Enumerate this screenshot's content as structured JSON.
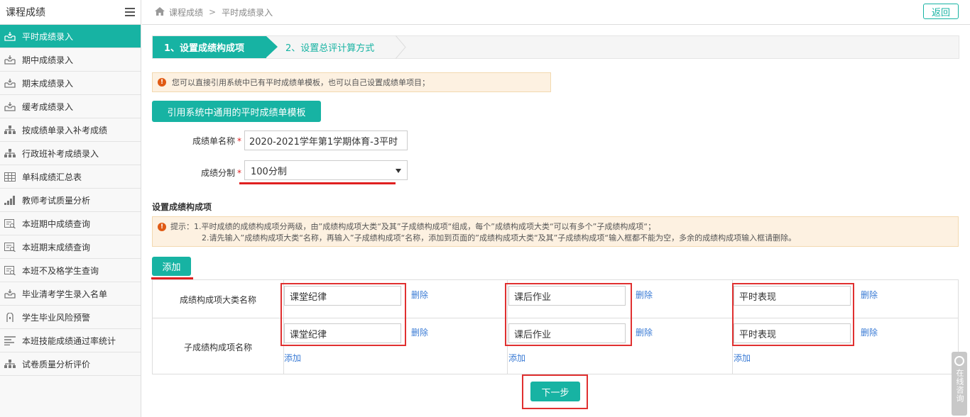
{
  "sidebar": {
    "title": "课程成绩",
    "items": [
      {
        "label": "平时成绩录入",
        "icon": "inbox-icon",
        "active": true
      },
      {
        "label": "期中成绩录入",
        "icon": "inbox-icon"
      },
      {
        "label": "期末成绩录入",
        "icon": "inbox-icon"
      },
      {
        "label": "缓考成绩录入",
        "icon": "inbox-icon"
      },
      {
        "label": "按成绩单录入补考成绩",
        "icon": "sitemap-icon"
      },
      {
        "label": "行政班补考成绩录入",
        "icon": "sitemap-icon"
      },
      {
        "label": "单科成绩汇总表",
        "icon": "table-icon"
      },
      {
        "label": "教师考试质量分析",
        "icon": "signal-icon"
      },
      {
        "label": "本班期中成绩查询",
        "icon": "search-list-icon"
      },
      {
        "label": "本班期末成绩查询",
        "icon": "search-list-icon"
      },
      {
        "label": "本班不及格学生查询",
        "icon": "search-list-icon"
      },
      {
        "label": "毕业清考学生录入名单",
        "icon": "inbox-icon"
      },
      {
        "label": "学生毕业风险预警",
        "icon": "lock-icon"
      },
      {
        "label": "本班技能成绩通过率统计",
        "icon": "align-left-icon"
      },
      {
        "label": "试卷质量分析评价",
        "icon": "sitemap-icon"
      }
    ]
  },
  "header": {
    "breadcrumb": [
      "课程成绩",
      "平时成绩录入"
    ],
    "back_label": "返回"
  },
  "steps": {
    "step1": "1、设置成绩构成项",
    "step2": "2、设置总评计算方式"
  },
  "notice1": "您可以直接引用系统中已有平时成绩单模板，也可以自己设置成绩单项目；",
  "template_button": "引用系统中通用的平时成绩单模板",
  "form": {
    "name_label": "成绩单名称",
    "name_value": "2020-2021学年第1学期体育-3平时",
    "grade_label": "成绩分制",
    "grade_value": "100分制",
    "required_mark": "*"
  },
  "section_title": "设置成绩构成项",
  "notice2": {
    "line1": "提示：1.平时成绩的成绩构成项分两级，由”成绩构成项大类“及其”子成绩构成项“组成，每个”成绩构成项大类“可以有多个”子成绩构成项“；",
    "line2": "2.请先输入”成绩构成项大类“名称，再输入”子成绩构成项“名称，添加到页面的”成绩构成项大类“及其”子成绩构成项“输入框都不能为空，多余的成绩构成项输入框请删除。"
  },
  "add_button": "添加",
  "table": {
    "row1_label": "成绩构成项大类名称",
    "row2_label": "子成绩构成项名称",
    "delete_label": "删除",
    "add_label": "添加",
    "columns": [
      {
        "category": "课堂纪律",
        "sub": "课堂纪律"
      },
      {
        "category": "课后作业",
        "sub": "课后作业"
      },
      {
        "category": "平时表现",
        "sub": "平时表现"
      }
    ]
  },
  "next_button": "下一步",
  "chat_label": "在线咨询",
  "colors": {
    "accent": "#17b3a3",
    "highlight": "#e03030"
  }
}
